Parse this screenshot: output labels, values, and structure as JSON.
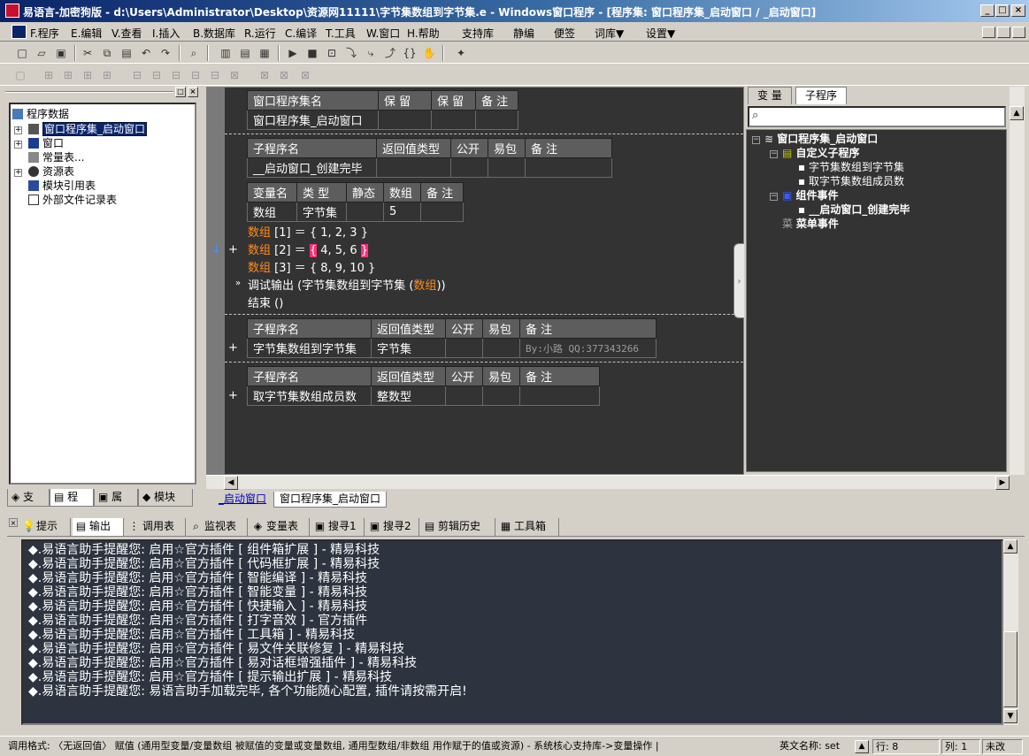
{
  "window": {
    "title": "易语言-加密狗版 - d:\\Users\\Administrator\\Desktop\\资源网11111\\字节集数组到字节集.e - Windows窗口程序 - [程序集: 窗口程序集_启动窗口 / _启动窗口]",
    "controls": [
      "_",
      "□",
      "×"
    ]
  },
  "menu": [
    {
      "label": "F.程序"
    },
    {
      "label": "E.编辑"
    },
    {
      "label": "V.查看"
    },
    {
      "label": "I.插入"
    },
    {
      "label": "B.数据库"
    },
    {
      "label": "R.运行"
    },
    {
      "label": "C.编译"
    },
    {
      "label": "T.工具"
    },
    {
      "label": "W.窗口"
    },
    {
      "label": "H.帮助"
    },
    {
      "label": "支持库"
    },
    {
      "label": "静编"
    },
    {
      "label": "便签"
    },
    {
      "label": "词库▼"
    },
    {
      "label": "设置▼"
    }
  ],
  "left_panel": {
    "tree": [
      {
        "label": "程序数据",
        "icon": "database-icon",
        "level": 0
      },
      {
        "label": "窗口程序集_启动窗口",
        "icon": "module-icon",
        "level": 1,
        "selected": true
      },
      {
        "label": "窗口",
        "icon": "window-icon",
        "level": 1
      },
      {
        "label": "常量表...",
        "icon": "constant-icon",
        "level": 1
      },
      {
        "label": "资源表",
        "icon": "resource-icon",
        "level": 1
      },
      {
        "label": "模块引用表",
        "icon": "module-ref-icon",
        "level": 1
      },
      {
        "label": "外部文件记录表",
        "icon": "file-icon",
        "level": 1
      }
    ],
    "tabs": [
      {
        "label": "支",
        "icon": "support-icon"
      },
      {
        "label": "程",
        "icon": "program-icon"
      },
      {
        "label": "属",
        "icon": "property-icon"
      },
      {
        "label": "模块",
        "icon": "module-tab-icon"
      }
    ]
  },
  "editor": {
    "assembly_table": {
      "headers": [
        "窗口程序集名",
        "保 留",
        "保 留",
        "备 注"
      ],
      "row": [
        "窗口程序集_启动窗口",
        "",
        "",
        ""
      ]
    },
    "sub1_table": {
      "headers": [
        "子程序名",
        "返回值类型",
        "公开",
        "易包",
        "备 注"
      ],
      "row": [
        "__启动窗口_创建完毕",
        "",
        "",
        "",
        ""
      ]
    },
    "var_table": {
      "headers": [
        "变量名",
        "类 型",
        "静态",
        "数组",
        "备 注"
      ],
      "row": [
        "数组",
        "字节集",
        "",
        "5",
        ""
      ]
    },
    "code": {
      "line1": {
        "var": "数组",
        "rest": " [1] ＝ { 1, 2, 3 }"
      },
      "line2": {
        "var": "数组",
        "mid": " [2] ＝ ",
        "brace": "{",
        "inner": " 4, 5, 6 ",
        "brace2": "}"
      },
      "line3": {
        "var": "数组",
        "rest": " [3] ＝ { 8, 9, 10 }"
      },
      "line4": {
        "pre": "调试输出 (字节集数组到字节集 (",
        "var": "数组",
        "post": "))"
      },
      "line5": "结束 ()"
    },
    "sub2_table": {
      "headers": [
        "子程序名",
        "返回值类型",
        "公开",
        "易包",
        "备 注"
      ],
      "row": [
        "字节集数组到字节集",
        "字节集",
        "",
        "",
        "By:小路 QQ:377343266"
      ]
    },
    "sub3_table": {
      "headers": [
        "子程序名",
        "返回值类型",
        "公开",
        "易包",
        "备 注"
      ],
      "row": [
        "取字节集数组成员数",
        "整数型",
        "",
        "",
        ""
      ]
    },
    "tabs": [
      "_启动窗口",
      "窗口程序集_启动窗口"
    ]
  },
  "right_panel": {
    "tabs": [
      "变 量",
      "子程序"
    ],
    "tree": [
      {
        "label": "窗口程序集_启动窗口",
        "bold": true
      },
      {
        "label": "自定义子程序",
        "bold": true
      },
      {
        "label": "字节集数组到字节集",
        "bold": false
      },
      {
        "label": "取字节集数组成员数",
        "bold": false
      },
      {
        "label": "组件事件",
        "bold": true
      },
      {
        "label": "__启动窗口_创建完毕",
        "bold": true
      },
      {
        "label": "菜单事件",
        "bold": true
      }
    ]
  },
  "bottom_tabs": [
    {
      "label": "提示",
      "icon": "hint-icon"
    },
    {
      "label": "输出",
      "icon": "output-icon"
    },
    {
      "label": "调用表",
      "icon": "calltable-icon"
    },
    {
      "label": "监视表",
      "icon": "watch-icon"
    },
    {
      "label": "变量表",
      "icon": "variable-icon"
    },
    {
      "label": "搜寻1",
      "icon": "search1-icon"
    },
    {
      "label": "搜寻2",
      "icon": "search2-icon"
    },
    {
      "label": "剪辑历史",
      "icon": "clipboard-icon"
    },
    {
      "label": "工具箱",
      "icon": "toolbox-icon"
    }
  ],
  "output_lines": [
    "◆.易语言助手提醒您: 启用☆官方插件 [ 组件箱扩展 ] - 精易科技",
    "◆.易语言助手提醒您: 启用☆官方插件 [ 代码框扩展 ] - 精易科技",
    "◆.易语言助手提醒您: 启用☆官方插件 [ 智能编译 ] - 精易科技",
    "◆.易语言助手提醒您: 启用☆官方插件 [ 智能变量 ] - 精易科技",
    "◆.易语言助手提醒您: 启用☆官方插件 [ 快捷输入 ] - 精易科技",
    "◆.易语言助手提醒您: 启用☆官方插件 [ 打字音效 ] - 官方插件",
    "◆.易语言助手提醒您: 启用☆官方插件 [ 工具箱 ] - 精易科技",
    "◆.易语言助手提醒您: 启用☆官方插件 [ 易文件关联修复 ] - 精易科技",
    "◆.易语言助手提醒您: 启用☆官方插件 [ 易对话框增强插件 ] - 精易科技",
    "◆.易语言助手提醒您: 启用☆官方插件 [ 提示输出扩展 ] - 精易科技",
    "◆.易语言助手提醒您: 易语言助手加载完毕, 各个功能随心配置, 插件请按需开启!"
  ],
  "status": {
    "call_format": "调用格式: 〈无返回值〉 赋值 (通用型变量/变量数组 被赋值的变量或变量数组, 通用型数组/非数组 用作赋于的值或资源) - 系统核心支持库->变量操作 |",
    "en_name": "英文名称: set",
    "line": "行: 8",
    "col": "列: 1",
    "modified": "未改"
  }
}
